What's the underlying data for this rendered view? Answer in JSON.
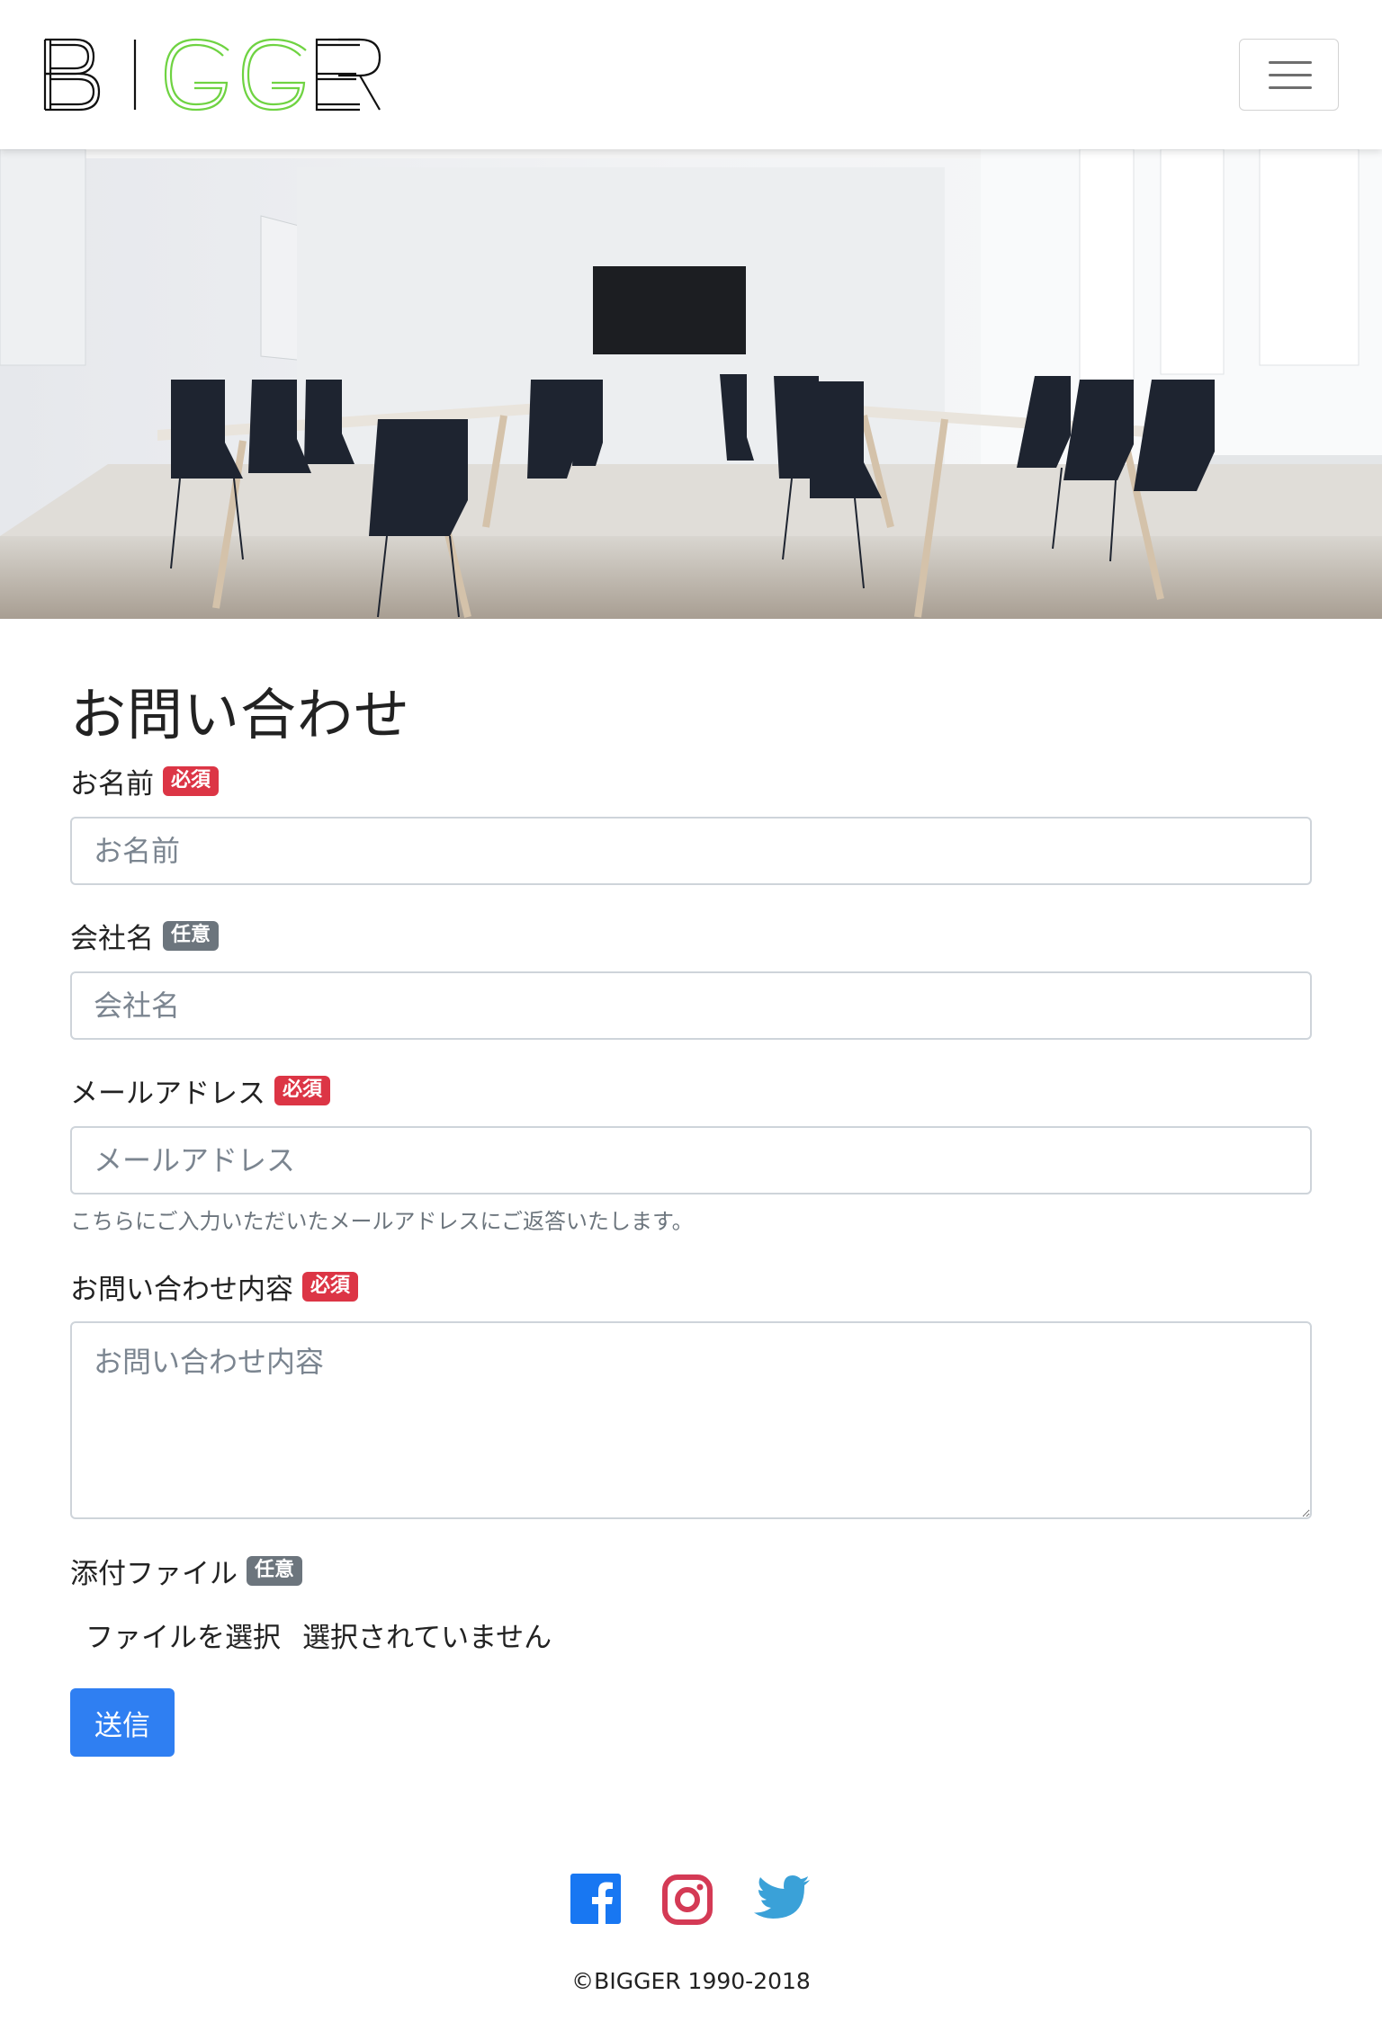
{
  "header": {
    "logo": {
      "letters": [
        "B",
        "I",
        "G",
        "G",
        "E",
        "R"
      ],
      "accent_color": "#6fd342",
      "text_color": "#111111"
    },
    "menu_icon": "hamburger-icon"
  },
  "form": {
    "title": "お問い合わせ",
    "fields": {
      "name": {
        "label": "お名前",
        "badge": "必須",
        "placeholder": "お名前"
      },
      "company": {
        "label": "会社名",
        "badge": "任意",
        "placeholder": "会社名"
      },
      "email": {
        "label": "メールアドレス",
        "badge": "必須",
        "placeholder": "メールアドレス",
        "help": "こちらにご入力いただいたメールアドレスにご返答いたします。"
      },
      "message": {
        "label": "お問い合わせ内容",
        "badge": "必須",
        "placeholder": "お問い合わせ内容"
      },
      "attachment": {
        "label": "添付ファイル",
        "badge": "任意",
        "button_text": "ファイルを選択",
        "status_text": "選択されていません"
      }
    },
    "submit_label": "送信",
    "colors": {
      "required": "#dc3545",
      "optional": "#6c757d",
      "submit": "#2f7ff2"
    }
  },
  "footer": {
    "social": [
      {
        "icon": "facebook-icon",
        "color": "#1877f2"
      },
      {
        "icon": "instagram-icon",
        "color": "#d43a55"
      },
      {
        "icon": "twitter-icon",
        "color": "#3aa1d8"
      }
    ],
    "copyright": "©BIGGER 1990-2018"
  }
}
